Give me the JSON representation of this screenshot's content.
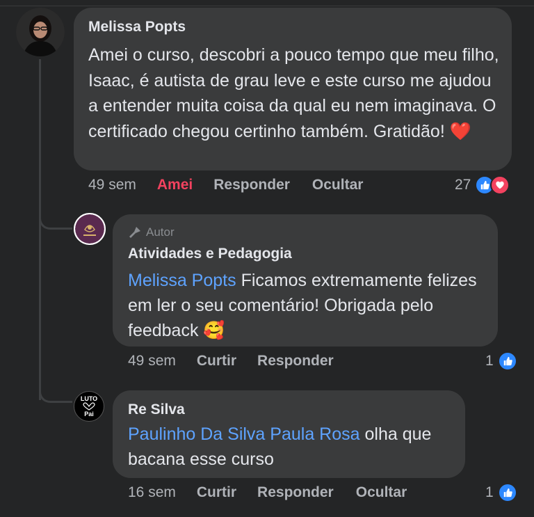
{
  "comments": [
    {
      "author": "Melissa Popts",
      "text": "Amei o curso, descobri a pouco tempo que meu filho, Isaac, é autista de grau leve e este curso me ajudou a entender muita coisa da qual eu nem imaginava. O certificado chegou certinho também. Gratidão!",
      "emoji": "❤️",
      "time": "49 sem",
      "reaction_label": "Amei",
      "reply_label": "Responder",
      "hide_label": "Ocultar",
      "reaction_count": "27"
    }
  ],
  "replies": [
    {
      "badge": "Autor",
      "author": "Atividades e Pedagogia",
      "mention": "Melissa Popts",
      "text": "Ficamos extremamente felizes em ler o seu comentário! Obrigada pelo feedback",
      "emoji": "🥰",
      "time": "49 sem",
      "like_label": "Curtir",
      "reply_label": "Responder",
      "reaction_count": "1"
    },
    {
      "author": "Re Silva",
      "avatar_text_top": "LUTO",
      "avatar_text_bottom": "Pai",
      "mention": "Paulinho Da Silva Paula Rosa",
      "text": "olha que bacana esse curso",
      "time": "16 sem",
      "like_label": "Curtir",
      "reply_label": "Responder",
      "hide_label": "Ocultar",
      "reaction_count": "1"
    }
  ],
  "colors": {
    "background": "#242526",
    "bubble": "#3a3b3c",
    "mention": "#5ea3ff",
    "love": "#f3425f",
    "like": "#2d88ff"
  }
}
